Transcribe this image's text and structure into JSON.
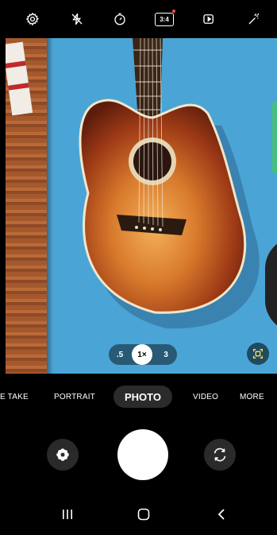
{
  "top_bar": {
    "icons": [
      "settings-icon",
      "flash-off-icon",
      "timer-icon",
      "aspect-ratio-icon",
      "motion-photo-icon",
      "filter-effects-icon"
    ],
    "aspect_ratio_label": "3:4",
    "accent_dot_color": "#ff4f3f"
  },
  "viewfinder": {
    "zoom": {
      "options": [
        ".5",
        "1×",
        "3"
      ],
      "selected": "1×"
    }
  },
  "modes": {
    "items": [
      "E TAKE",
      "PORTRAIT",
      "PHOTO",
      "VIDEO",
      "MORE"
    ],
    "selected": "PHOTO"
  },
  "controls": {
    "left_icon": "effects-flower-icon",
    "center": "shutter-button",
    "right_icon": "switch-camera-icon"
  },
  "navigation": {
    "icons": [
      "recent-apps-icon",
      "home-icon",
      "back-icon"
    ]
  }
}
